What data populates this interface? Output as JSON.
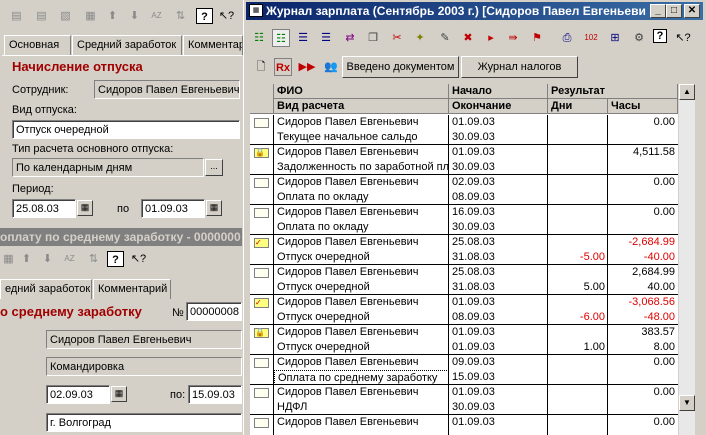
{
  "left_top": {
    "tabs": [
      "Основная",
      "Средний заработок",
      "Комментарий"
    ],
    "title": "Начисление отпуска",
    "employee_label": "Сотрудник:",
    "employee_value": "Сидоров Павел Евгеньевич",
    "vacation_type_label": "Вид отпуска:",
    "vacation_type_value": "Отпуск очередной",
    "calc_type_label": "Тип расчета основного отпуска:",
    "calc_type_value": "По календарным дням",
    "period_label": "Период:",
    "period_from": "25.08.03",
    "period_to_label": "по",
    "period_to": "01.09.03"
  },
  "left_bottom": {
    "window_title": "оплату по среднему заработку - 0000000",
    "tabs": [
      "едний заработок",
      "Комментарий"
    ],
    "title": "о среднему заработку",
    "number_label": "№",
    "number_value": "00000008",
    "employee_value": "Сидоров Павел Евгеньевич",
    "type_value": "Командировка",
    "date_from": "02.09.03",
    "date_to_label": "по:",
    "date_to": "15.09.03",
    "city_value": "г. Волгоград"
  },
  "journal": {
    "window_title": "Журнал зарплата (Сентябрь 2003 г.) [Сидоров Павел Евгеньеви",
    "buttons": {
      "entered": "Введено документом",
      "tax_journal": "Журнал налогов"
    },
    "headers": {
      "fio": "ФИО",
      "start": "Начало",
      "result": "Результат",
      "calc_type": "Вид расчета",
      "end": "Окончание",
      "days": "Дни",
      "hours": "Часы"
    },
    "rows": [
      {
        "fio": "Сидоров Павел Евгеньевич",
        "type": "Текущее начальное сальдо",
        "start": "01.09.03",
        "end": "30.09.03",
        "amount": "0.00",
        "days": "",
        "hours": "",
        "icon": "doc",
        "red": false
      },
      {
        "fio": "Сидоров Павел Евгеньевич",
        "type": "Задолженность по заработной пл",
        "start": "01.09.03",
        "end": "30.09.03",
        "amount": "4,511.58",
        "days": "",
        "hours": "",
        "icon": "lock",
        "red": false
      },
      {
        "fio": "Сидоров Павел Евгеньевич",
        "type": "Оплата по окладу",
        "start": "02.09.03",
        "end": "08.09.03",
        "amount": "0.00",
        "days": "",
        "hours": "",
        "icon": "doc",
        "red": false
      },
      {
        "fio": "Сидоров Павел Евгеньевич",
        "type": "Оплата по окладу",
        "start": "16.09.03",
        "end": "30.09.03",
        "amount": "0.00",
        "days": "",
        "hours": "",
        "icon": "doc",
        "red": false
      },
      {
        "fio": "Сидоров Павел Евгеньевич",
        "type": "Отпуск очередной",
        "start": "25.08.03",
        "end": "31.08.03",
        "amount": "-2,684.99",
        "days": "-5.00",
        "hours": "-40.00",
        "icon": "check",
        "red": true
      },
      {
        "fio": "Сидоров Павел Евгеньевич",
        "type": "Отпуск очередной",
        "start": "25.08.03",
        "end": "31.08.03",
        "amount": "2,684.99",
        "days": "5.00",
        "hours": "40.00",
        "icon": "doc",
        "red": false
      },
      {
        "fio": "Сидоров Павел Евгеньевич",
        "type": "Отпуск очередной",
        "start": "01.09.03",
        "end": "08.09.03",
        "amount": "-3,068.56",
        "days": "-6.00",
        "hours": "-48.00",
        "icon": "check",
        "red": true
      },
      {
        "fio": "Сидоров Павел Евгеньевич",
        "type": "Отпуск очередной",
        "start": "01.09.03",
        "end": "01.09.03",
        "amount": "383.57",
        "days": "1.00",
        "hours": "8.00",
        "icon": "lock",
        "red": false
      },
      {
        "fio": "Сидоров Павел Евгеньевич",
        "type": "Оплата по среднему заработку",
        "start": "09.09.03",
        "end": "15.09.03",
        "amount": "0.00",
        "days": "",
        "hours": "",
        "icon": "doc",
        "red": false,
        "selected": true
      },
      {
        "fio": "Сидоров Павел Евгеньевич",
        "type": "НДФЛ",
        "start": "01.09.03",
        "end": "30.09.03",
        "amount": "0.00",
        "days": "",
        "hours": "",
        "icon": "doc",
        "red": false
      },
      {
        "fio": "Сидоров Павел Евгеньевич",
        "type": "",
        "start": "01.09.03",
        "end": "",
        "amount": "0.00",
        "days": "",
        "hours": "",
        "icon": "doc",
        "red": false
      }
    ]
  },
  "colors": {
    "titlebar": "#0a246a",
    "titlebar_inactive": "#808080",
    "accent_red": "#a00000"
  }
}
